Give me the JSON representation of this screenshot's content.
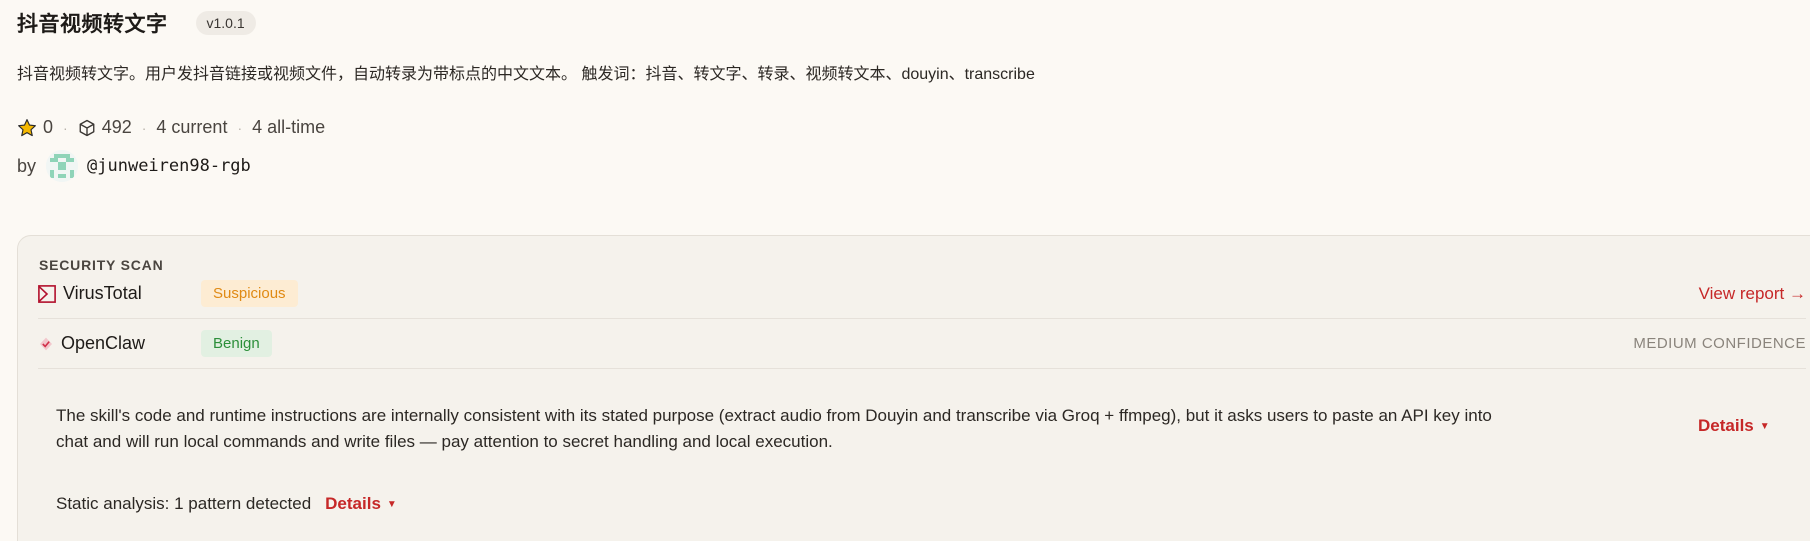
{
  "skill": {
    "title": "抖音视频转文字",
    "version": "v1.0.1",
    "description": "抖音视频转文字。用户发抖音链接或视频文件，自动转录为带标点的中文文本。 触发词：抖音、转文字、转录、视频转文本、douyin、transcribe",
    "stars": "0",
    "downloads": "492",
    "current_installs": "4 current",
    "alltime_installs": "4 all-time",
    "by_label": "by",
    "author_handle": "@junweiren98-rgb"
  },
  "security_scan": {
    "title": "SECURITY SCAN",
    "scanners": [
      {
        "name": "VirusTotal",
        "verdict": "Suspicious",
        "action": "View report →",
        "icon": "virustotal-icon"
      },
      {
        "name": "OpenClaw",
        "verdict": "Benign",
        "confidence": "MEDIUM CONFIDENCE",
        "icon": "openclaw-icon"
      }
    ],
    "summary": "The skill's code and runtime instructions are internally consistent with its stated purpose (extract audio from Douyin and transcribe via Groq + ffmpeg), but it asks users to paste an API key into chat and will run local commands and write files — pay attention to secret handling and local execution.",
    "details_label": "Details",
    "static_analysis": "Static analysis: 1 pattern detected",
    "static_details_label": "Details"
  },
  "colors": {
    "accent": "#c62828",
    "suspicious": "#e08a14",
    "benign": "#2c8f3a",
    "background": "#fcf9f4"
  }
}
